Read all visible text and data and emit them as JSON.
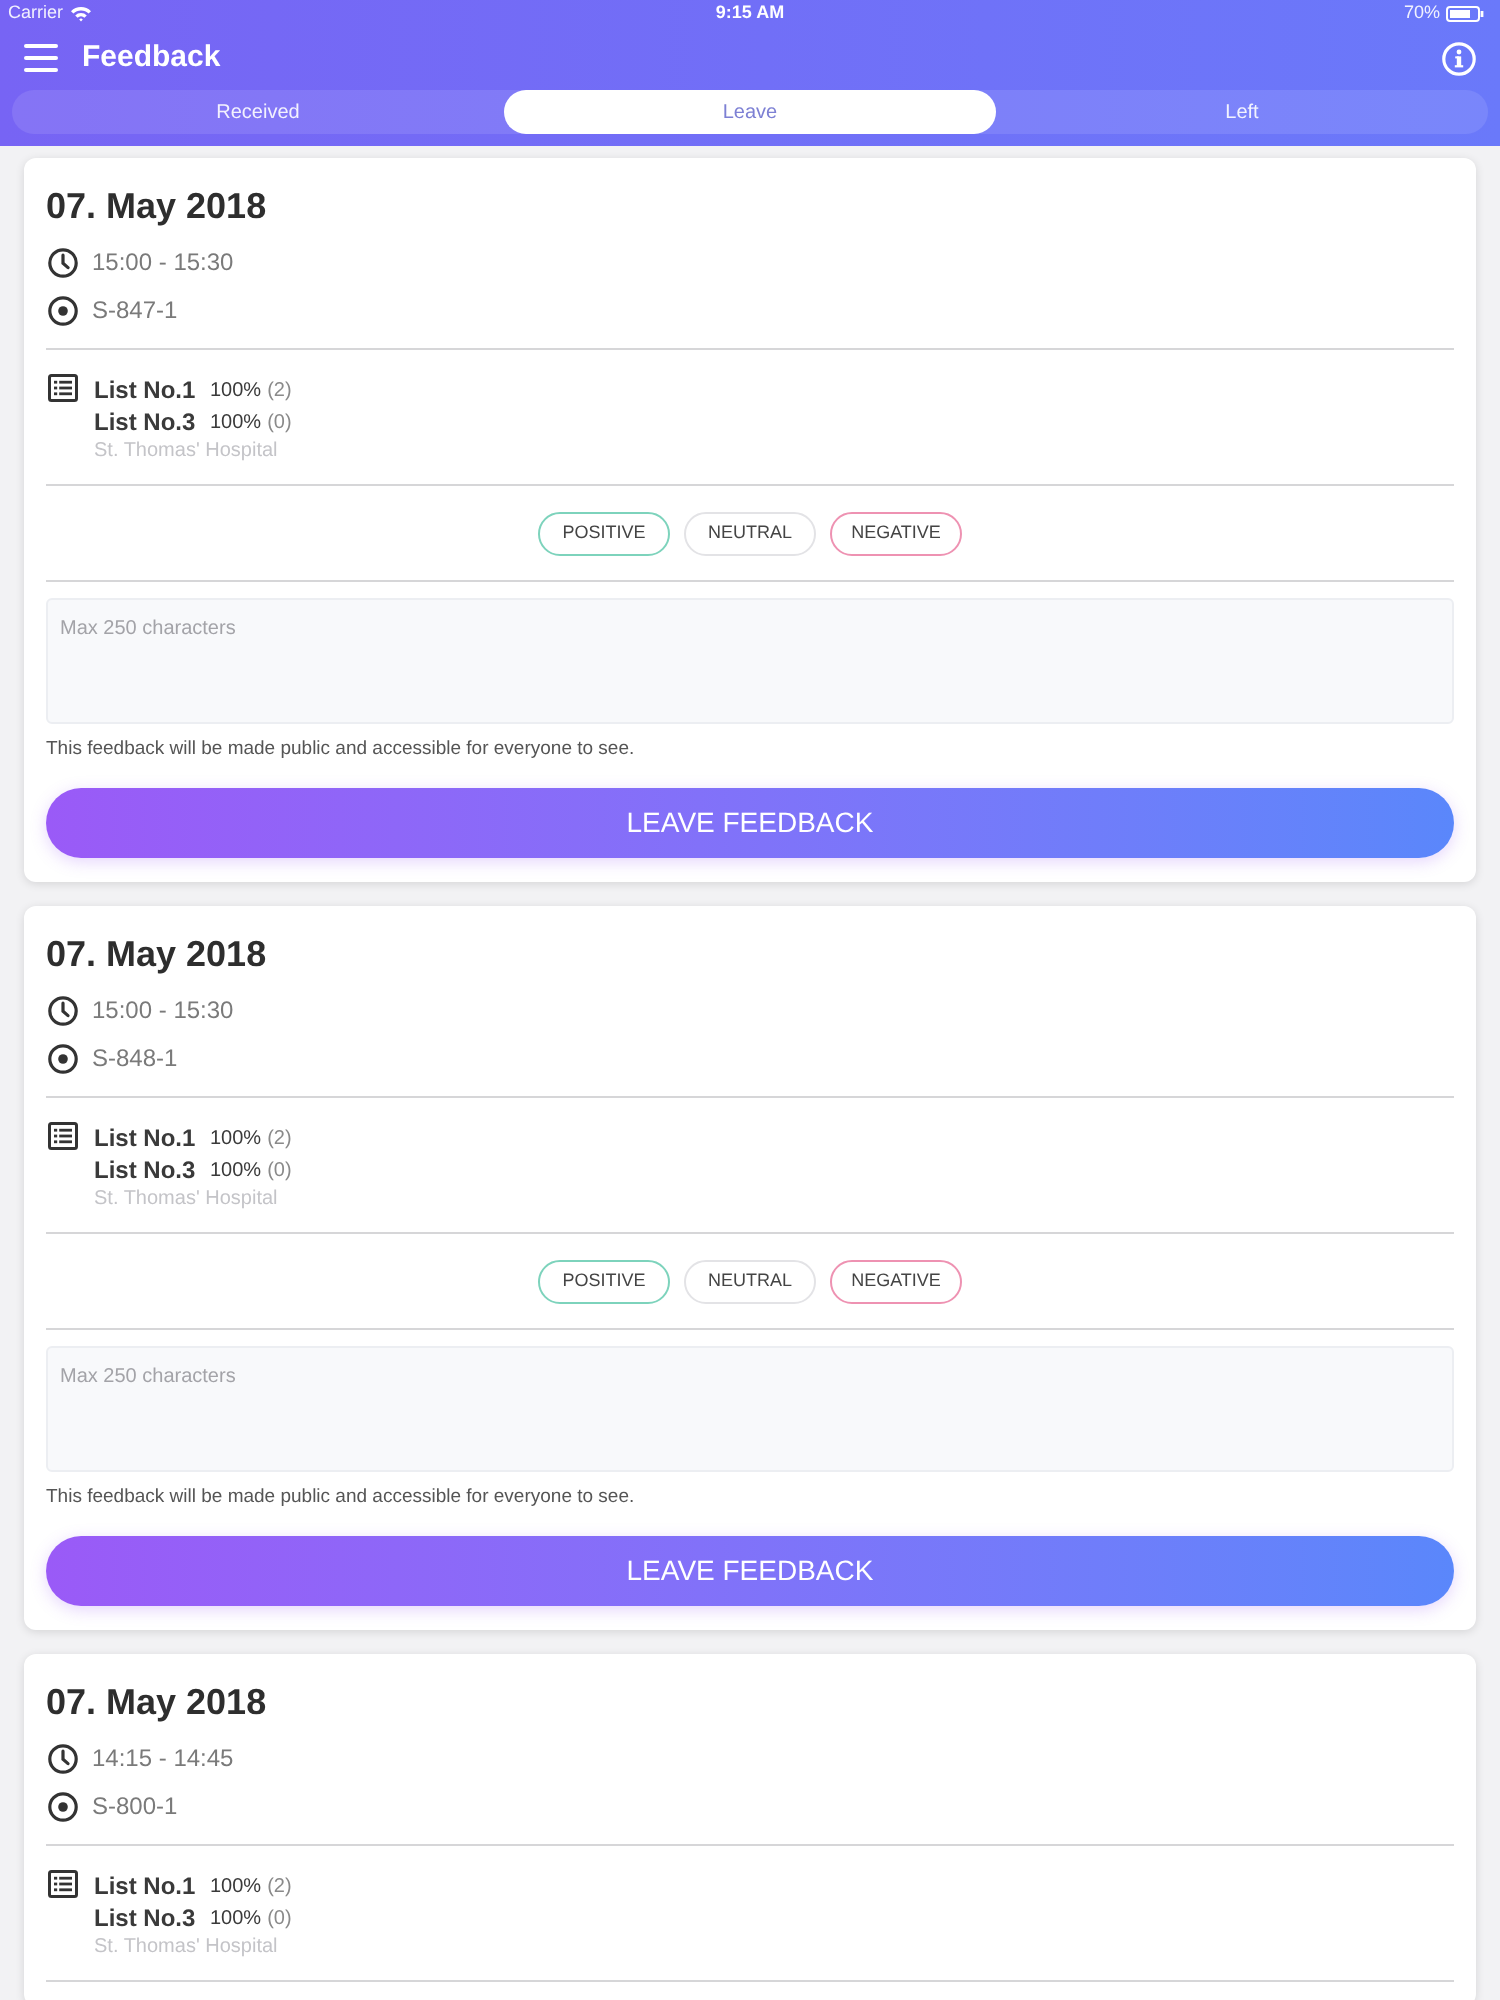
{
  "status_bar": {
    "carrier": "Carrier",
    "time": "9:15 AM",
    "battery": "70%"
  },
  "header": {
    "title": "Feedback"
  },
  "tabs": [
    {
      "label": "Received",
      "selected": false
    },
    {
      "label": "Leave",
      "selected": true
    },
    {
      "label": "Left",
      "selected": false
    }
  ],
  "cards": [
    {
      "date": "07. May 2018",
      "time": "15:00 - 15:30",
      "code": "S-847-1",
      "lists": [
        {
          "name": "List No.1",
          "percent": "100%",
          "count": "(2)"
        },
        {
          "name": "List No.3",
          "percent": "100%",
          "count": "(0)"
        }
      ],
      "location": "St. Thomas' Hospital",
      "ratings": [
        {
          "label": "POSITIVE",
          "color": "#7dd3bc"
        },
        {
          "label": "NEUTRAL",
          "color": "#e3e3e6"
        },
        {
          "label": "NEGATIVE",
          "color": "#ee92b2"
        }
      ],
      "comment": {
        "placeholder": "Max 250 characters"
      },
      "note": "This feedback will be made public and accessible for everyone to see.",
      "button": "LEAVE FEEDBACK"
    },
    {
      "date": "07. May 2018",
      "time": "15:00 - 15:30",
      "code": "S-848-1",
      "lists": [
        {
          "name": "List No.1",
          "percent": "100%",
          "count": "(2)"
        },
        {
          "name": "List No.3",
          "percent": "100%",
          "count": "(0)"
        }
      ],
      "location": "St. Thomas' Hospital",
      "ratings": [
        {
          "label": "POSITIVE",
          "color": "#7dd3bc"
        },
        {
          "label": "NEUTRAL",
          "color": "#e3e3e6"
        },
        {
          "label": "NEGATIVE",
          "color": "#ee92b2"
        }
      ],
      "comment": {
        "placeholder": "Max 250 characters"
      },
      "note": "This feedback will be made public and accessible for everyone to see.",
      "button": "LEAVE FEEDBACK"
    },
    {
      "date": "07. May 2018",
      "time": "14:15 - 14:45",
      "code": "S-800-1",
      "lists": [
        {
          "name": "List No.1",
          "percent": "100%",
          "count": "(2)"
        },
        {
          "name": "List No.3",
          "percent": "100%",
          "count": "(0)"
        }
      ],
      "location": "St. Thomas' Hospital"
    }
  ]
}
